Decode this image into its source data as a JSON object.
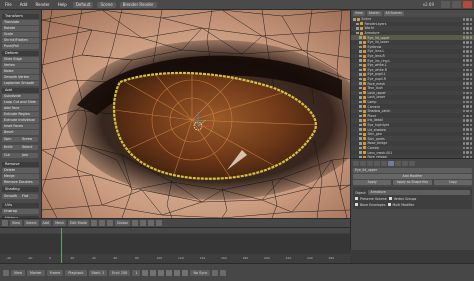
{
  "topbar": {
    "menus": [
      "File",
      "Add",
      "Render",
      "Help"
    ],
    "layout": "Default",
    "scene": "Scene",
    "engine": "Blender Render",
    "stats": "v2.69"
  },
  "toolshelf": {
    "sections": [
      {
        "title": "Transform",
        "tools": [
          "Translate",
          "Rotate",
          "Scale",
          "Shrink/Flatten",
          "Push/Pull"
        ]
      },
      {
        "title": "Deform",
        "tools": [
          "Slide Edge",
          "Vertex",
          "Noise",
          "Smooth Vertex",
          "Laplacian Smooth"
        ]
      },
      {
        "title": "Add",
        "tools": [
          "Subdivide",
          "Loop Cut and Slide",
          "Add Face",
          "Extrude Region",
          "Extrude Individual",
          "Inset Faces",
          "Bevel",
          "Spin",
          "Screw",
          "Knife",
          "Select",
          "Cut",
          "Join"
        ]
      },
      {
        "title": "Remove",
        "tools": [
          "Delete",
          "Merge",
          "Remove Doubles"
        ]
      },
      {
        "title": "Shading",
        "tools": [
          "Smooth",
          "Flat"
        ]
      },
      {
        "title": "UVs",
        "tools": [
          "Unwrap"
        ]
      },
      {
        "title": "History",
        "tools": [
          "Undo",
          "Redo",
          "Undo History",
          "Repeat Last",
          "Repeat History"
        ]
      }
    ]
  },
  "viewport_header": {
    "view": "View",
    "select": "Select",
    "add": "Add",
    "mesh": "Mesh",
    "mode": "Edit Mode",
    "pivot": "Global"
  },
  "outliner": {
    "view": "View",
    "search": "Search",
    "display": "All Scenes",
    "rows": [
      "Scene",
      "RenderLayers",
      "World",
      "Armature",
      "Eye_lid_upper",
      "Eye_lid_lower",
      "Eyebrow",
      "Eye_lens.L",
      "Eye_lens.R",
      "Eye_iris_ring.L",
      "Eye_white.L",
      "Eye_white.R",
      "Eye_pupil.L",
      "Eye_pupil.R",
      "Face_mesh",
      "Tear_duct",
      "Lash_upper",
      "Lash_lower",
      "Lamp",
      "Camera",
      "Shadow_catch",
      "Plane",
      "Iris_detail",
      "Eye_highlight",
      "Lid_shadow",
      "Skin_geo",
      "Skin_pores",
      "Nose_bridge",
      "Cornea",
      "Lens_mesh.001",
      "Face_retopo"
    ]
  },
  "properties": {
    "object": "Eye_lid_upper",
    "add_modifier": "Add Modifier",
    "apply": "Apply",
    "apply_shape": "Apply as Shape Key",
    "copy": "Copy",
    "armature_label": "Armature:",
    "object_label": "Object:",
    "vertex_group": "Vertex Groups",
    "bind_to": "Bind To:",
    "multi_modifier": "Multi Modifier",
    "preserve_volume": "Preserve Volume",
    "bone_envelopes": "Bone Envelopes"
  },
  "timeline": {
    "ticks": [
      "-40",
      "-20",
      "0",
      "20",
      "40",
      "60",
      "80",
      "100",
      "120",
      "140",
      "160",
      "180",
      "200",
      "220",
      "240",
      "260"
    ],
    "current_frame": 1
  },
  "bottombar": {
    "view": "View",
    "marker": "Marker",
    "frame": "Frame",
    "playback": "Playback",
    "start": "Start: 1",
    "end": "End: 250",
    "current": "1",
    "sync": "No Sync"
  },
  "colors": {
    "selection_edge": "#d8c23a",
    "wire": "#111111"
  }
}
